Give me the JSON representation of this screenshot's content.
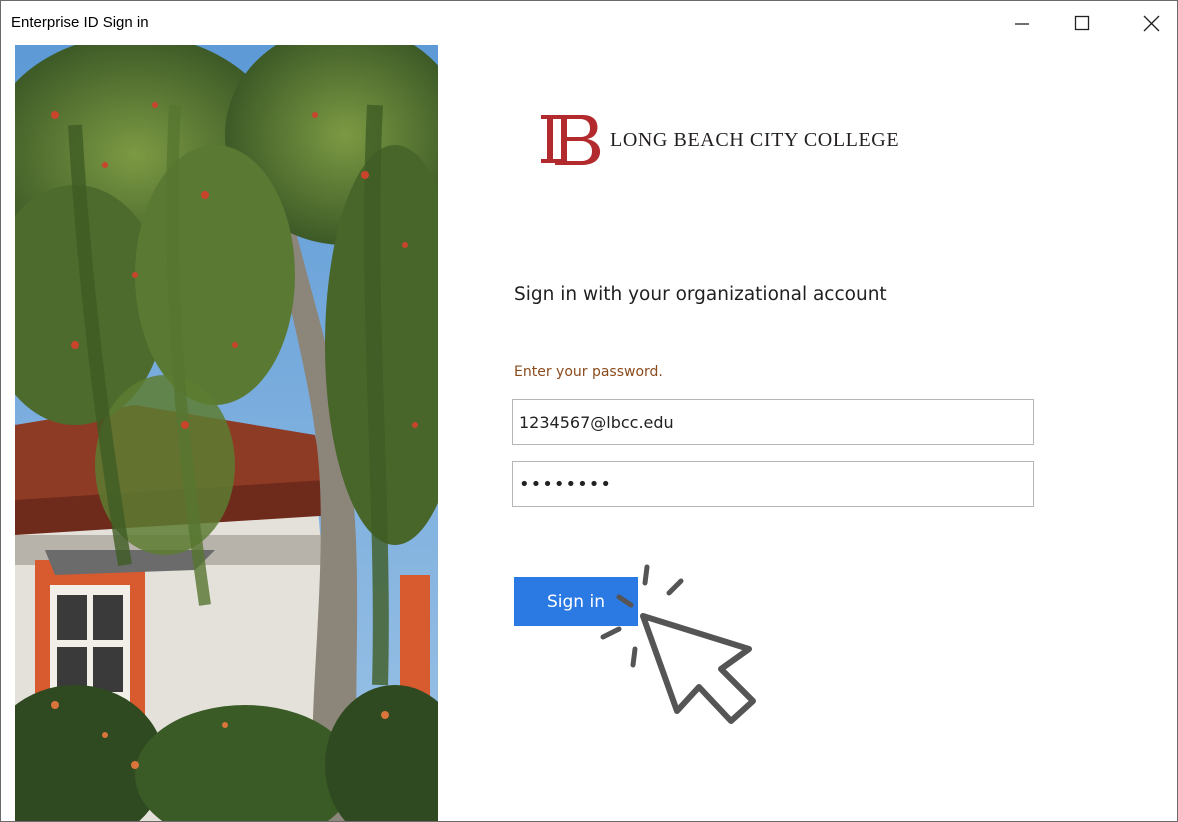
{
  "window": {
    "title": "Enterprise ID Sign in",
    "controls": {
      "minimize": "minimize-icon",
      "maximize": "maximize-icon",
      "close": "close-icon"
    }
  },
  "logo": {
    "mark": "LB",
    "name": "LONG BEACH CITY COLLEGE",
    "mark_color": "#b22a2e"
  },
  "form": {
    "heading": "Sign in with your organizational account",
    "prompt": "Enter your password.",
    "email_value": "1234567@lbcc.edu",
    "password_value": "••••••••",
    "submit_label": "Sign in"
  },
  "colors": {
    "accent": "#2b7ae4",
    "prompt_text": "#8a4b1d"
  },
  "decorations": {
    "cursor": "pointer-click-icon",
    "photo": "campus-building-tree-photo"
  }
}
